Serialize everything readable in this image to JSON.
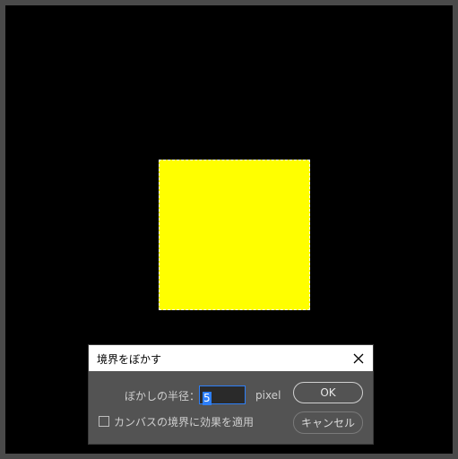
{
  "dialog": {
    "title": "境界をぼかす",
    "radius_label": "ぼかしの半径：",
    "radius_value": "5",
    "unit": "pixel",
    "ok_label": "OK",
    "cancel_label": "キャンセル",
    "checkbox_label": "カンバスの境界に効果を適用",
    "checkbox_checked": false
  },
  "canvas": {
    "background_color": "#000000",
    "selection_fill_color": "#ffff00"
  },
  "icons": {
    "close": "close-icon"
  },
  "colors": {
    "focus_accent": "#2d7ff9",
    "dialog_background": "#535353"
  }
}
